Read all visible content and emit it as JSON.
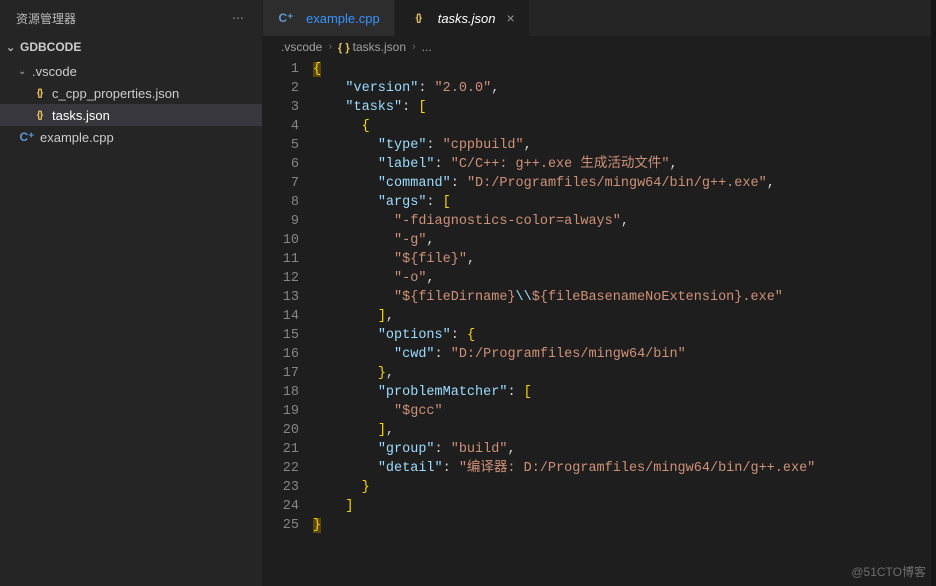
{
  "sidebar": {
    "title": "资源管理器",
    "project": "GDBCODE",
    "folder": ".vscode",
    "files": [
      {
        "name": "c_cpp_properties.json",
        "icon": "json"
      },
      {
        "name": "tasks.json",
        "icon": "json",
        "selected": true
      }
    ],
    "root_files": [
      {
        "name": "example.cpp",
        "icon": "cpp"
      }
    ]
  },
  "tabs": [
    {
      "label": "example.cpp",
      "icon": "cpp",
      "active": false
    },
    {
      "label": "tasks.json",
      "icon": "json",
      "active": true,
      "closeable": true
    }
  ],
  "breadcrumb": {
    "seg1": ".vscode",
    "seg2": "tasks.json",
    "seg3": "..."
  },
  "code": {
    "lines": [
      {
        "n": 1,
        "i": 0,
        "tokens": [
          {
            "c": "b",
            "t": "{"
          }
        ],
        "hl": true
      },
      {
        "n": 2,
        "i": 2,
        "tokens": [
          {
            "c": "k",
            "t": "\"version\""
          },
          {
            "c": "p",
            "t": ": "
          },
          {
            "c": "s",
            "t": "\"2.0.0\""
          },
          {
            "c": "p",
            "t": ","
          }
        ]
      },
      {
        "n": 3,
        "i": 2,
        "tokens": [
          {
            "c": "k",
            "t": "\"tasks\""
          },
          {
            "c": "p",
            "t": ": "
          },
          {
            "c": "b",
            "t": "["
          }
        ]
      },
      {
        "n": 4,
        "i": 3,
        "tokens": [
          {
            "c": "b",
            "t": "{"
          }
        ]
      },
      {
        "n": 5,
        "i": 4,
        "tokens": [
          {
            "c": "k",
            "t": "\"type\""
          },
          {
            "c": "p",
            "t": ": "
          },
          {
            "c": "s",
            "t": "\"cppbuild\""
          },
          {
            "c": "p",
            "t": ","
          }
        ]
      },
      {
        "n": 6,
        "i": 4,
        "tokens": [
          {
            "c": "k",
            "t": "\"label\""
          },
          {
            "c": "p",
            "t": ": "
          },
          {
            "c": "s",
            "t": "\"C/C++: g++.exe 生成活动文件\""
          },
          {
            "c": "p",
            "t": ","
          }
        ]
      },
      {
        "n": 7,
        "i": 4,
        "tokens": [
          {
            "c": "k",
            "t": "\"command\""
          },
          {
            "c": "p",
            "t": ": "
          },
          {
            "c": "s",
            "t": "\"D:/Programfiles/mingw64/bin/g++.exe\""
          },
          {
            "c": "p",
            "t": ","
          }
        ]
      },
      {
        "n": 8,
        "i": 4,
        "tokens": [
          {
            "c": "k",
            "t": "\"args\""
          },
          {
            "c": "p",
            "t": ": "
          },
          {
            "c": "b",
            "t": "["
          }
        ]
      },
      {
        "n": 9,
        "i": 5,
        "tokens": [
          {
            "c": "s",
            "t": "\"-fdiagnostics-color=always\""
          },
          {
            "c": "p",
            "t": ","
          }
        ]
      },
      {
        "n": 10,
        "i": 5,
        "tokens": [
          {
            "c": "s",
            "t": "\"-g\""
          },
          {
            "c": "p",
            "t": ","
          }
        ]
      },
      {
        "n": 11,
        "i": 5,
        "tokens": [
          {
            "c": "s",
            "t": "\"${file}\""
          },
          {
            "c": "p",
            "t": ","
          }
        ]
      },
      {
        "n": 12,
        "i": 5,
        "tokens": [
          {
            "c": "s",
            "t": "\"-o\""
          },
          {
            "c": "p",
            "t": ","
          }
        ]
      },
      {
        "n": 13,
        "i": 5,
        "tokens": [
          {
            "c": "s",
            "t": "\"${fileDirname}"
          },
          {
            "c": "k",
            "t": "\\\\"
          },
          {
            "c": "s",
            "t": "${fileBasenameNoExtension}.exe\""
          }
        ]
      },
      {
        "n": 14,
        "i": 4,
        "tokens": [
          {
            "c": "b",
            "t": "]"
          },
          {
            "c": "p",
            "t": ","
          }
        ]
      },
      {
        "n": 15,
        "i": 4,
        "tokens": [
          {
            "c": "k",
            "t": "\"options\""
          },
          {
            "c": "p",
            "t": ": "
          },
          {
            "c": "b",
            "t": "{"
          }
        ]
      },
      {
        "n": 16,
        "i": 5,
        "tokens": [
          {
            "c": "k",
            "t": "\"cwd\""
          },
          {
            "c": "p",
            "t": ": "
          },
          {
            "c": "s",
            "t": "\"D:/Programfiles/mingw64/bin\""
          }
        ]
      },
      {
        "n": 17,
        "i": 4,
        "tokens": [
          {
            "c": "b",
            "t": "}"
          },
          {
            "c": "p",
            "t": ","
          }
        ]
      },
      {
        "n": 18,
        "i": 4,
        "tokens": [
          {
            "c": "k",
            "t": "\"problemMatcher\""
          },
          {
            "c": "p",
            "t": ": "
          },
          {
            "c": "b",
            "t": "["
          }
        ]
      },
      {
        "n": 19,
        "i": 5,
        "tokens": [
          {
            "c": "s",
            "t": "\"$gcc\""
          }
        ]
      },
      {
        "n": 20,
        "i": 4,
        "tokens": [
          {
            "c": "b",
            "t": "]"
          },
          {
            "c": "p",
            "t": ","
          }
        ]
      },
      {
        "n": 21,
        "i": 4,
        "tokens": [
          {
            "c": "k",
            "t": "\"group\""
          },
          {
            "c": "p",
            "t": ": "
          },
          {
            "c": "s",
            "t": "\"build\""
          },
          {
            "c": "p",
            "t": ","
          }
        ]
      },
      {
        "n": 22,
        "i": 4,
        "tokens": [
          {
            "c": "k",
            "t": "\"detail\""
          },
          {
            "c": "p",
            "t": ": "
          },
          {
            "c": "s",
            "t": "\"编译器: D:/Programfiles/mingw64/bin/g++.exe\""
          }
        ]
      },
      {
        "n": 23,
        "i": 3,
        "tokens": [
          {
            "c": "b",
            "t": "}"
          }
        ]
      },
      {
        "n": 24,
        "i": 2,
        "tokens": [
          {
            "c": "b",
            "t": "]"
          }
        ]
      },
      {
        "n": 25,
        "i": 0,
        "tokens": [
          {
            "c": "b",
            "t": "}"
          }
        ],
        "hl": true
      }
    ]
  },
  "watermark": "@51CTO博客"
}
